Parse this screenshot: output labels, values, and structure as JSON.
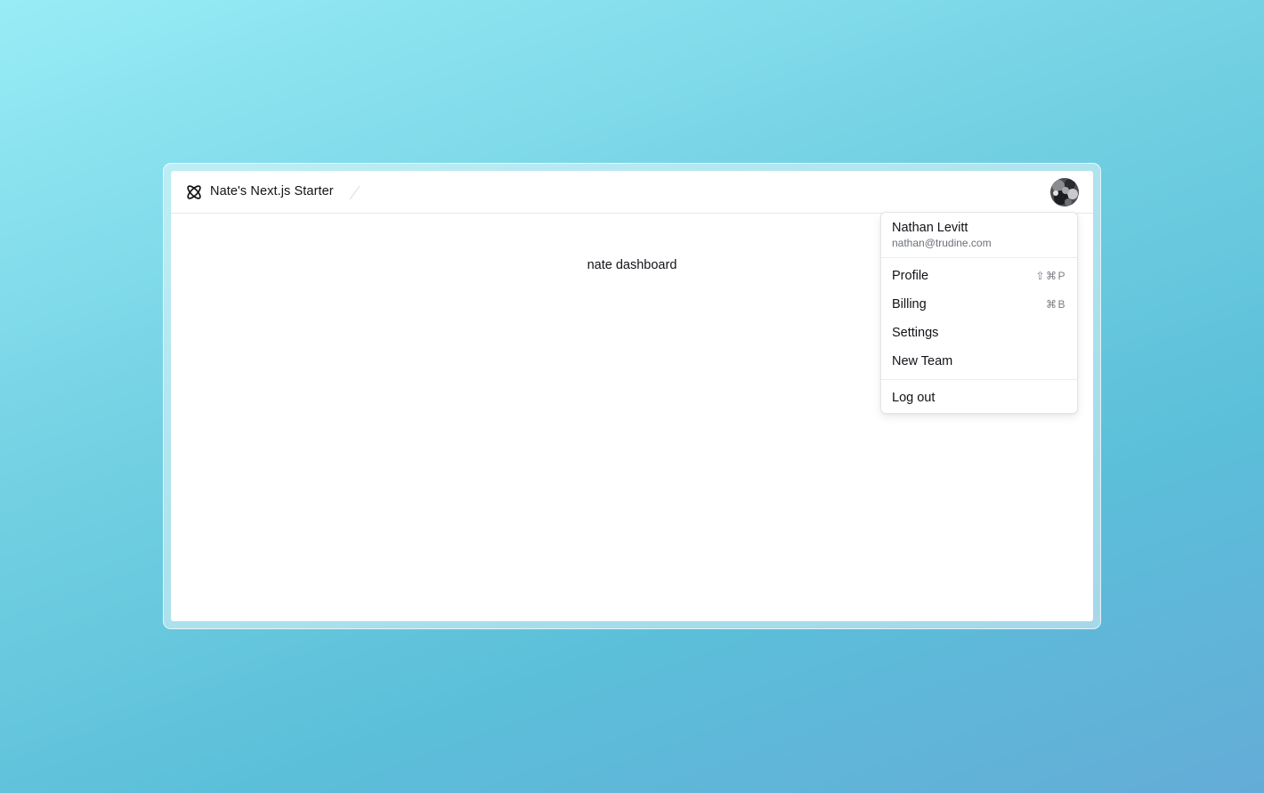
{
  "app": {
    "title": "Nate's Next.js Starter"
  },
  "main": {
    "text": "nate dashboard"
  },
  "user_menu": {
    "name": "Nathan Levitt",
    "email": "nathan@trudine.com",
    "items": [
      {
        "label": "Profile",
        "shortcut": "⇧⌘P"
      },
      {
        "label": "Billing",
        "shortcut": "⌘B"
      },
      {
        "label": "Settings",
        "shortcut": ""
      },
      {
        "label": "New Team",
        "shortcut": ""
      }
    ],
    "logout_label": "Log out"
  },
  "icons": {
    "logo": "atom-icon",
    "avatar": "user-avatar"
  },
  "colors": {
    "background_start": "#98ecf6",
    "background_end": "#64acd8",
    "text": "#111318",
    "muted": "#6b6f76"
  }
}
